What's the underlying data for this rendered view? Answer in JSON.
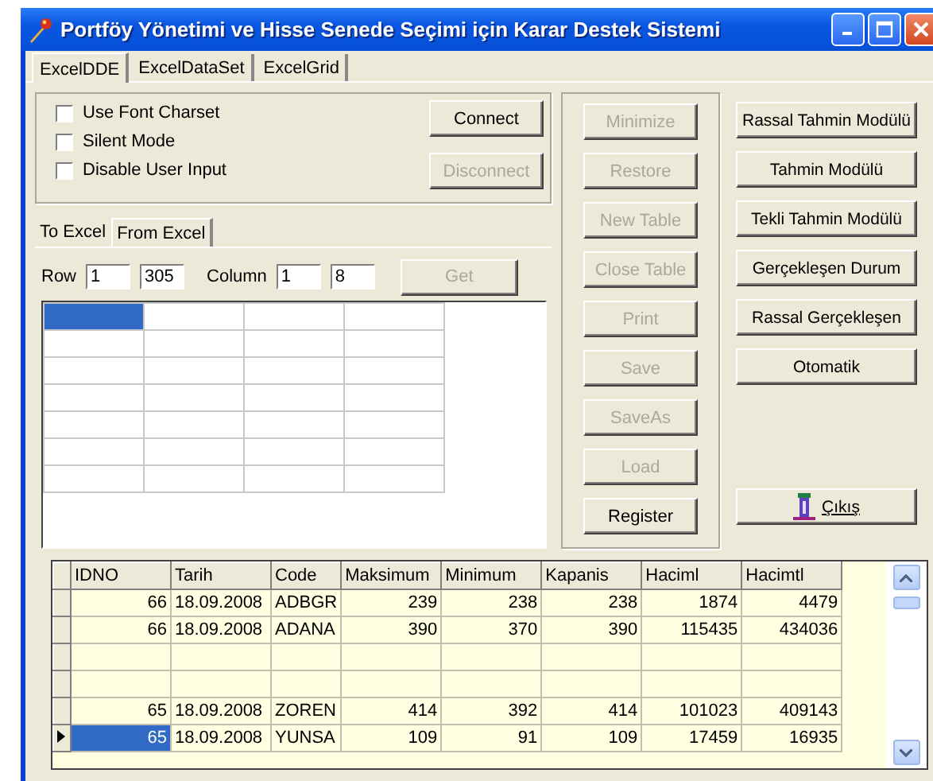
{
  "window": {
    "title": "Portföy Yönetimi ve Hisse Senede Seçimi için Karar Destek Sistemi"
  },
  "tabs": [
    {
      "label": "ExcelDDE",
      "selected": true
    },
    {
      "label": "ExcelDataSet",
      "selected": false
    },
    {
      "label": "ExcelGrid",
      "selected": false
    }
  ],
  "options": [
    {
      "label": "Use Font Charset",
      "checked": false
    },
    {
      "label": "Silent Mode",
      "checked": false
    },
    {
      "label": "Disable User Input",
      "checked": false
    }
  ],
  "connection_buttons": [
    {
      "label": "Connect",
      "disabled": false
    },
    {
      "label": "Disconnect",
      "disabled": true
    }
  ],
  "sub_tabs": [
    {
      "label": "To Excel",
      "selected": false
    },
    {
      "label": "From Excel",
      "selected": true
    }
  ],
  "range": {
    "row_label": "Row",
    "row_from": "1",
    "row_to": "305",
    "column_label": "Column",
    "column_from": "1",
    "column_to": "8",
    "get_button": {
      "label": "Get",
      "disabled": true
    }
  },
  "sheet": {
    "rows": [
      {
        "cells": [
          {
            "selected": true
          },
          {
            "selected": false
          },
          {
            "selected": false
          },
          {
            "selected": false
          }
        ]
      },
      {
        "cells": [
          {
            "selected": false
          },
          {
            "selected": false
          },
          {
            "selected": false
          },
          {
            "selected": false
          }
        ]
      },
      {
        "cells": [
          {
            "selected": false
          },
          {
            "selected": false
          },
          {
            "selected": false
          },
          {
            "selected": false
          }
        ]
      },
      {
        "cells": [
          {
            "selected": false
          },
          {
            "selected": false
          },
          {
            "selected": false
          },
          {
            "selected": false
          }
        ]
      },
      {
        "cells": [
          {
            "selected": false
          },
          {
            "selected": false
          },
          {
            "selected": false
          },
          {
            "selected": false
          }
        ]
      },
      {
        "cells": [
          {
            "selected": false
          },
          {
            "selected": false
          },
          {
            "selected": false
          },
          {
            "selected": false
          }
        ]
      },
      {
        "cells": [
          {
            "selected": false
          },
          {
            "selected": false
          },
          {
            "selected": false
          },
          {
            "selected": false
          }
        ]
      }
    ]
  },
  "table_buttons": [
    {
      "label": "Minimize",
      "disabled": true
    },
    {
      "label": "Restore",
      "disabled": true
    },
    {
      "label": "New Table",
      "disabled": true
    },
    {
      "label": "Close Table",
      "disabled": true
    },
    {
      "label": "Print",
      "disabled": true
    },
    {
      "label": "Save",
      "disabled": true
    },
    {
      "label": "SaveAs",
      "disabled": true
    },
    {
      "label": "Load",
      "disabled": true
    },
    {
      "label": "Register",
      "disabled": false
    }
  ],
  "module_buttons": [
    {
      "label": "Rassal Tahmin Modülü"
    },
    {
      "label": "Tahmin Modülü"
    },
    {
      "label": "Tekli Tahmin Modülü"
    },
    {
      "label": "Gerçekleşen Durum"
    },
    {
      "label": "Rassal Gerçekleşen"
    },
    {
      "label": "Otomatik"
    }
  ],
  "exit_button": {
    "label": "Çıkış"
  },
  "table": {
    "columns": [
      "IDNO",
      "Tarih",
      "Code",
      "Maksimum",
      "Minimum",
      "Kapanis",
      "Haciml",
      "Hacimtl"
    ],
    "rows": [
      {
        "selected": false,
        "cells": [
          "66",
          "18.09.2008",
          "ADBGR",
          "239",
          "238",
          "238",
          "1874",
          "4479"
        ]
      },
      {
        "selected": false,
        "cells": [
          "66",
          "18.09.2008",
          "ADANA",
          "390",
          "370",
          "390",
          "115435",
          "434036"
        ]
      },
      {
        "selected": false,
        "cells": []
      },
      {
        "selected": false,
        "cells": []
      },
      {
        "selected": false,
        "cells": [
          "65",
          "18.09.2008",
          "ZOREN",
          "414",
          "392",
          "414",
          "101023",
          "409143"
        ]
      },
      {
        "selected": true,
        "cells": [
          "65",
          "18.09.2008",
          "YUNSA",
          "109",
          "91",
          "109",
          "17459",
          "16935"
        ]
      }
    ]
  }
}
